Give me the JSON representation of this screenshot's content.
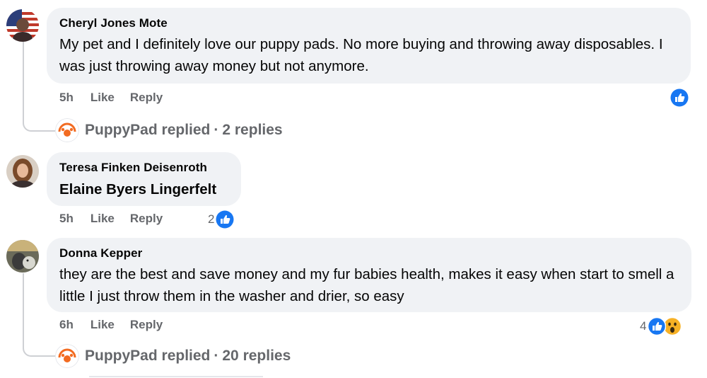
{
  "comments": [
    {
      "author": "Cheryl Jones Mote",
      "text": "My pet and I definitely love our puppy pads. No more buying and throwing away disposables. I was just throwing away money but not anymore.",
      "time": "5h",
      "like_label": "Like",
      "reply_label": "Reply",
      "reaction_count": "",
      "replied_by": "PuppyPad replied",
      "replies_count": "2 replies"
    },
    {
      "author": "Teresa Finken Deisenroth",
      "text": "Elaine Byers Lingerfelt",
      "time": "5h",
      "like_label": "Like",
      "reply_label": "Reply",
      "reaction_count": "2"
    },
    {
      "author": "Donna Kepper",
      "text": "they are the best and save money and my fur babies health, makes it easy when start to smell a little I just throw them in the washer and drier, so easy",
      "time": "6h",
      "like_label": "Like",
      "reply_label": "Reply",
      "reaction_count": "4",
      "replied_by": "PuppyPad replied",
      "replies_count": "20 replies"
    }
  ],
  "separator": "·",
  "colors": {
    "bubble": "#f0f2f5",
    "secondary_text": "#65676b",
    "like_blue": "#1877f2",
    "wow_yellow": "#f7b125",
    "brand_orange": "#f26b21"
  }
}
